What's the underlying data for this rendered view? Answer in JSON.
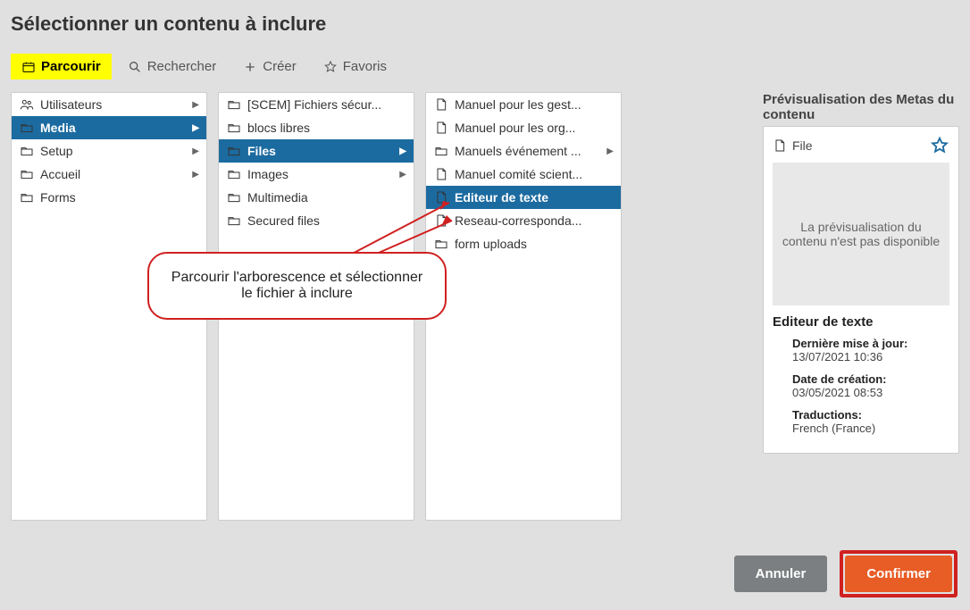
{
  "title": "Sélectionner un contenu à inclure",
  "tabs": {
    "browse": "Parcourir",
    "search": "Rechercher",
    "create": "Créer",
    "favorites": "Favoris"
  },
  "col1": [
    {
      "icon": "users",
      "label": "Utilisateurs",
      "arrow": true,
      "sel": false
    },
    {
      "icon": "folder",
      "label": "Media",
      "arrow": true,
      "sel": true
    },
    {
      "icon": "folder",
      "label": "Setup",
      "arrow": true,
      "sel": false
    },
    {
      "icon": "folder",
      "label": "Accueil",
      "arrow": true,
      "sel": false
    },
    {
      "icon": "folder",
      "label": "Forms",
      "arrow": false,
      "sel": false
    }
  ],
  "col2": [
    {
      "icon": "folder",
      "label": "[SCEM] Fichiers sécur...",
      "arrow": false,
      "sel": false
    },
    {
      "icon": "folder",
      "label": "blocs libres",
      "arrow": false,
      "sel": false
    },
    {
      "icon": "folder",
      "label": "Files",
      "arrow": true,
      "sel": true
    },
    {
      "icon": "folder",
      "label": "Images",
      "arrow": true,
      "sel": false
    },
    {
      "icon": "folder",
      "label": "Multimedia",
      "arrow": false,
      "sel": false
    },
    {
      "icon": "folder",
      "label": "Secured files",
      "arrow": false,
      "sel": false
    }
  ],
  "col3": [
    {
      "icon": "file",
      "label": "Manuel pour les gest...",
      "arrow": false,
      "sel": false
    },
    {
      "icon": "file",
      "label": "Manuel pour les org...",
      "arrow": false,
      "sel": false
    },
    {
      "icon": "folder",
      "label": "Manuels événement ...",
      "arrow": true,
      "sel": false
    },
    {
      "icon": "file",
      "label": "Manuel comité scient...",
      "arrow": false,
      "sel": false
    },
    {
      "icon": "file",
      "label": "Editeur de texte",
      "arrow": false,
      "sel": true
    },
    {
      "icon": "file",
      "label": "Reseau-corresponda...",
      "arrow": false,
      "sel": false
    },
    {
      "icon": "folder",
      "label": "form uploads",
      "arrow": false,
      "sel": false
    }
  ],
  "preview": {
    "heading": "Prévisualisation des Metas du contenu",
    "file_type": "File",
    "thumb_text": "La prévisualisation du contenu n'est pas disponible",
    "name": "Editeur de texte",
    "meta": {
      "updated_label": "Dernière mise à jour:",
      "updated_value": "13/07/2021 10:36",
      "created_label": "Date de création:",
      "created_value": "03/05/2021 08:53",
      "trans_label": "Traductions:",
      "trans_value": "French (France)"
    }
  },
  "footer": {
    "cancel": "Annuler",
    "confirm": "Confirmer"
  },
  "callout": "Parcourir l'arborescence et sélectionner le fichier à inclure"
}
